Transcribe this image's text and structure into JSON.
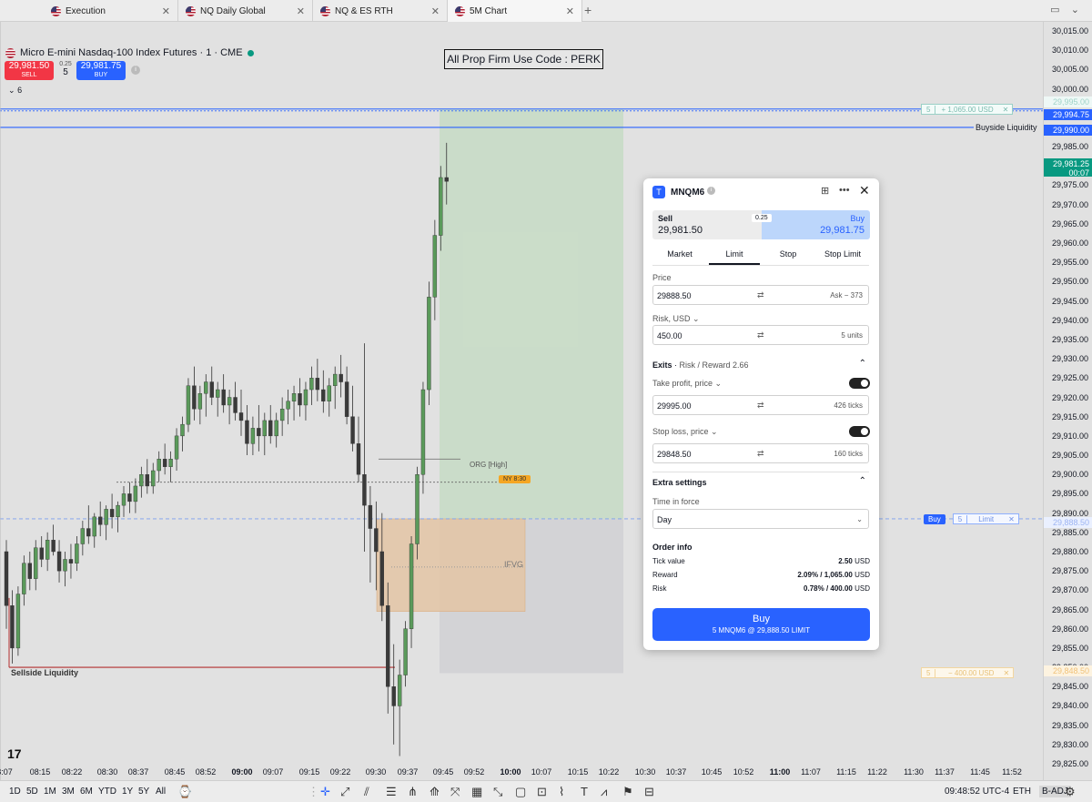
{
  "tabs": [
    {
      "label": "Execution"
    },
    {
      "label": "NQ Daily Global"
    },
    {
      "label": "NQ & ES RTH"
    },
    {
      "label": "5M Chart"
    }
  ],
  "symbol": {
    "title": "Micro E-mini Nasdaq-100 Index Futures · 1 · CME",
    "sell_price": "29,981.50",
    "sell_label": "SELL",
    "spread": "0.25",
    "qty": "5",
    "buy_price": "29,981.75",
    "buy_label": "BUY",
    "indicator_count": "6"
  },
  "promo": "All Prop Firm Use Code : PERK",
  "price_scale": [
    "30,015.00",
    "30,010.00",
    "30,005.00",
    "30,000.00",
    "29,985.00",
    "29,975.00",
    "29,970.00",
    "29,965.00",
    "29,960.00",
    "29,955.00",
    "29,950.00",
    "29,945.00",
    "29,940.00",
    "29,935.00",
    "29,930.00",
    "29,925.00",
    "29,920.00",
    "29,915.00",
    "29,910.00",
    "29,905.00",
    "29,900.00",
    "29,895.00",
    "29,890.00",
    "29,885.00",
    "29,880.00",
    "29,875.00",
    "29,870.00",
    "29,865.00",
    "29,860.00",
    "29,855.00",
    "29,850.00",
    "29,845.00",
    "29,840.00",
    "29,835.00",
    "29,830.00",
    "29,825.00"
  ],
  "price_tags": {
    "tp_gray": "29,995.00",
    "tp_blue": "29,994.75",
    "buyside": "29,990.00",
    "last": "29,981.25",
    "countdown": "00:07",
    "limit": "29,888.50",
    "sl": "29,848.50"
  },
  "time_axis": [
    "8:07",
    "08:15",
    "08:22",
    "08:30",
    "08:37",
    "08:45",
    "08:52",
    "09:00",
    "09:07",
    "09:15",
    "09:22",
    "09:30",
    "09:37",
    "09:45",
    "09:52",
    "10:00",
    "10:07",
    "10:15",
    "10:22",
    "10:30",
    "10:37",
    "10:45",
    "10:52",
    "11:00",
    "11:07",
    "11:15",
    "11:22",
    "11:30",
    "11:37",
    "11:45",
    "11:52"
  ],
  "annotations": {
    "buyside_liquidity": "Buyside Liquidity",
    "sellside_liquidity": "Sellside Liquidity",
    "org_high": "ORG [High]",
    "ny_open": "NY 8:30",
    "ifvg": "IFVG",
    "tp_qty": "5",
    "tp_reward": "+ 1,065.00 USD",
    "limit_side": "Buy",
    "limit_qty": "5",
    "limit_type": "Limit",
    "sl_qty": "5",
    "sl_risk": "− 400.00 USD"
  },
  "order_panel": {
    "symbol": "MNQM6",
    "sell_label": "Sell",
    "sell_price": "29,981.50",
    "spread": "0.25",
    "buy_label": "Buy",
    "buy_price": "29,981.75",
    "order_types": [
      "Market",
      "Limit",
      "Stop",
      "Stop Limit"
    ],
    "active_type": "Limit",
    "price_label": "Price",
    "price_value": "29888.50",
    "price_hint": "Ask − 373",
    "risk_label": "Risk, USD",
    "risk_value": "450.00",
    "risk_units": "5 units",
    "exits_label": "Exits",
    "exits_rr": "Risk / Reward 2.66",
    "tp_label": "Take profit, price",
    "tp_value": "29995.00",
    "tp_ticks": "426 ticks",
    "sl_label": "Stop loss, price",
    "sl_value": "29848.50",
    "sl_ticks": "160 ticks",
    "extra_label": "Extra settings",
    "tif_label": "Time in force",
    "tif_value": "Day",
    "order_info_label": "Order info",
    "tick_value_label": "Tick value",
    "tick_value": "2.50",
    "reward_label": "Reward",
    "reward_value": "2.09% / 1,065.00",
    "risk2_label": "Risk",
    "risk2_value": "0.78% / 400.00",
    "currency": "USD",
    "submit_label": "Buy",
    "submit_sub": "5 MNQM6 @ 29,888.50 LIMIT"
  },
  "bottom": {
    "ranges": [
      "1D",
      "5D",
      "1M",
      "3M",
      "6M",
      "YTD",
      "1Y",
      "5Y",
      "All"
    ],
    "clock": "09:48:52 UTC-4",
    "session": "ETH",
    "adj": "B-ADJ"
  },
  "colors": {
    "buy": "#2962ff",
    "sell": "#f23645",
    "profit_zone": "#c8dcc6",
    "loss_zone": "#d3d3d6",
    "ifvg_zone": "#e3c4a5",
    "candle_up": "#5a9a5a",
    "candle_down": "#3a3a3a"
  }
}
